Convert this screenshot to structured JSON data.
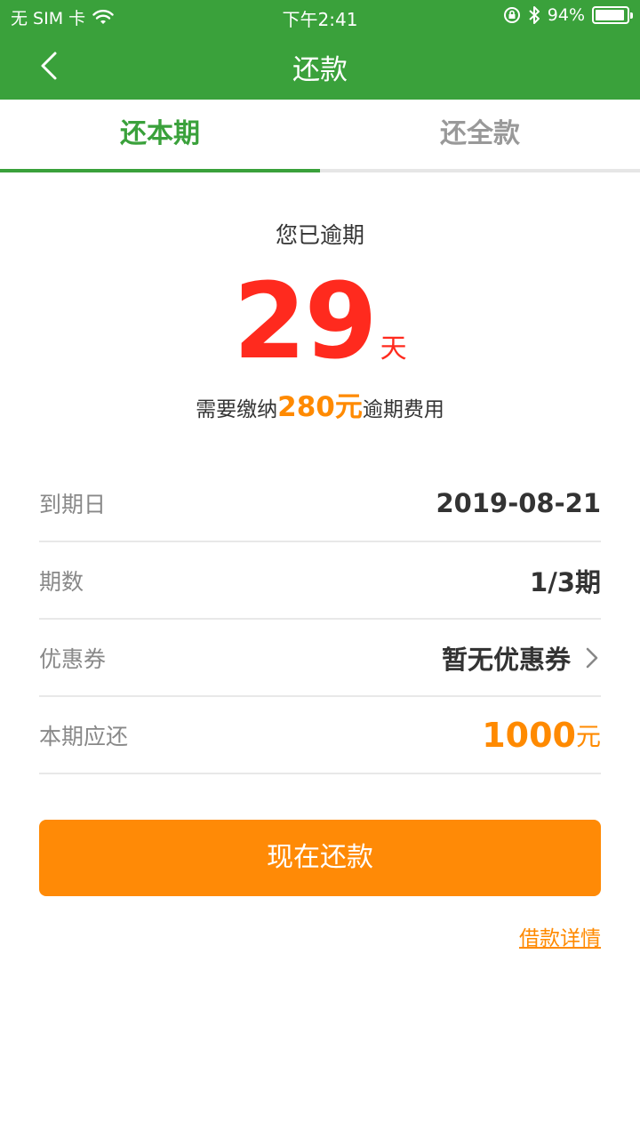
{
  "status_bar": {
    "carrier": "无 SIM 卡",
    "time": "下午2:41",
    "battery_text": "94%",
    "battery_level": 0.94
  },
  "navbar": {
    "title": "还款"
  },
  "tabs": [
    {
      "label": "还本期",
      "active": true
    },
    {
      "label": "还全款",
      "active": false
    }
  ],
  "overdue": {
    "heading": "您已逾期",
    "days": "29",
    "days_unit": "天",
    "fee_prefix": "需要缴纳",
    "fee_amount": "280元",
    "fee_suffix": "逾期费用"
  },
  "rows": [
    {
      "label": "到期日",
      "value": "2019-08-21"
    },
    {
      "label": "期数",
      "value": "1/3期"
    },
    {
      "label": "优惠券",
      "value": "暂无优惠券"
    },
    {
      "label": "本期应还",
      "value": "1000",
      "unit": "元"
    }
  ],
  "actions": {
    "pay_button": "现在还款",
    "details_link": "借款详情"
  },
  "colors": {
    "primary_green": "#3aa13b",
    "accent_orange": "#ff8a06",
    "alert_red": "#ff2a1e"
  }
}
